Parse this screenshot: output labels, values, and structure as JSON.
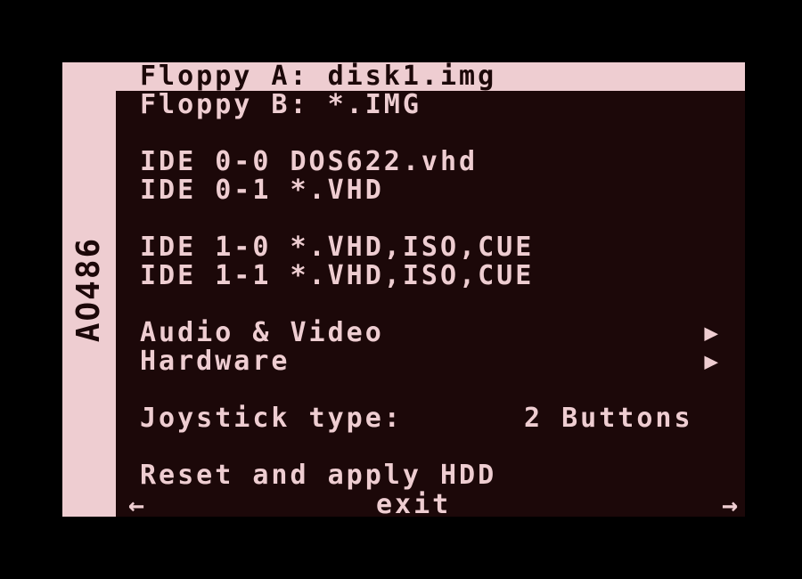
{
  "sidebar": {
    "label": "AO486"
  },
  "menu": {
    "items": [
      {
        "label": "Floppy A: disk1.img",
        "selected": true
      },
      {
        "label": "Floppy B: *.IMG"
      },
      {
        "label": "IDE 0-0 DOS622.vhd"
      },
      {
        "label": "IDE 0-1 *.VHD"
      },
      {
        "label": "IDE 1-0 *.VHD,ISO,CUE"
      },
      {
        "label": "IDE 1-1 *.VHD,ISO,CUE"
      },
      {
        "label": "Audio & Video",
        "arrow": "▶"
      },
      {
        "label": "Hardware",
        "arrow": "▶"
      },
      {
        "label": "Joystick type:",
        "value": "2 Buttons"
      },
      {
        "label": "Reset and apply HDD"
      }
    ],
    "exit_label": "exit",
    "nav_left": "←",
    "nav_right": "→"
  },
  "colors": {
    "background": "#000000",
    "panel": "#1c0809",
    "foreground": "#eecdd1"
  }
}
